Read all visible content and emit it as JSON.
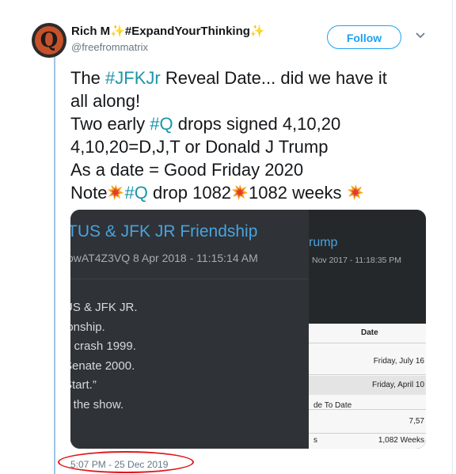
{
  "user": {
    "name": "Rich M✨#ExpandYourThinking✨",
    "handle": "@freefrommatrix",
    "avatar_letter": "Q"
  },
  "header": {
    "follow_label": "Follow"
  },
  "tweet": {
    "line1_prefix": "The ",
    "line1_tag": "#JFKJr",
    "line1_suffix": " Reveal Date... did we have it",
    "line2": "all along!",
    "line3_prefix": "Two early ",
    "line3_tag": "#Q",
    "line3_suffix": " drops signed 4,10,20",
    "line4": "4,10,20=D,J,T or Donald J Trump",
    "line5": "As a date = Good Friday 2020",
    "line6_prefix": "Note",
    "line6_tag": "#Q",
    "line6_mid": " drop 1082",
    "line6_suffix": "1082 weeks "
  },
  "media": {
    "left": {
      "title": "TUS & JFK JR Friendship",
      "meta": "owAT4Z3VQ  8 Apr 2018 - 11:15:14 AM",
      "body": [
        "US & JFK JR.",
        "ionship.",
        "e crash 1999.",
        "Senate 2000.",
        "Start.”",
        "y the show."
      ]
    },
    "right": {
      "title": "rump",
      "meta": "Nov 2017 - 11:18:35 PM",
      "table_header": "Date",
      "row1": "Friday, July 16",
      "row2": "Friday, April 10",
      "row3": "de To Date",
      "row4": "7,57",
      "row5_left": "s",
      "row5_right": "1,082 Weeks"
    }
  },
  "footer": {
    "timestamp": "5:07 PM - 25 Dec 2019"
  },
  "colors": {
    "hashtag": "#1b95a8",
    "follow": "#1da1f2",
    "highlight_oval": "#e0171b"
  }
}
